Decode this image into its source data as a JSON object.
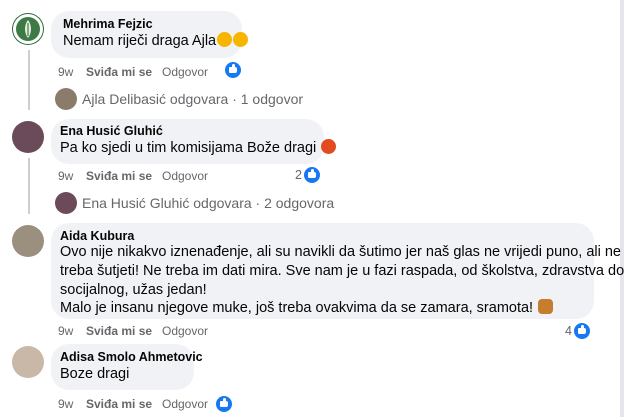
{
  "comments": [
    {
      "author": "Mehrima Fejzic",
      "text": "Nemam riječi draga Ajla",
      "time": "9w",
      "like_label": "Sviđa mi se",
      "reply_label": "Odgovor"
    },
    {
      "author": "Ena Husić Gluhić",
      "text": "Pa ko sjedi u tim komisijama Bože dragi",
      "time": "9w",
      "like_label": "Sviđa mi se",
      "reply_label": "Odgovor",
      "reaction_count": "2"
    },
    {
      "author": "Aida Kubura",
      "lines": [
        "Ovo nije nikakvo iznenađenje, ali su navikli da šutimo jer naš glas ne vrijedi puno, ali ne",
        "treba šutjeti! Ne treba im dati mira. Sve nam je u fazi raspada, od školstva, zdravstva do",
        "socijalnog, užas jedan!",
        "Malo je insanu njegove muke, još treba ovakvima da se zamara, sramota!"
      ],
      "time": "9w",
      "like_label": "Sviđa mi se",
      "reply_label": "Odgovor",
      "reaction_count": "4"
    },
    {
      "author": "Adisa Smolo Ahmetovic",
      "text": "Boze dragi",
      "time": "9w",
      "like_label": "Sviđa mi se",
      "reply_label": "Odgovor"
    }
  ],
  "replies": [
    {
      "text": "Ajla Delibasić odgovara · 1 odgovor"
    },
    {
      "text": "Ena Husić Gluhić odgovara · 2 odgovora"
    }
  ],
  "icons": {
    "like": "thumbs-up-icon",
    "emoji_1": "grinning-face-icon",
    "emoji_2": "kissing-face-icon",
    "emoji_3": "angry-face-icon",
    "emoji_4": "facepalm-icon"
  },
  "colors": {
    "like_blue": "#1877f2",
    "bubble": "#f0f2f5",
    "meta": "#65676b"
  }
}
